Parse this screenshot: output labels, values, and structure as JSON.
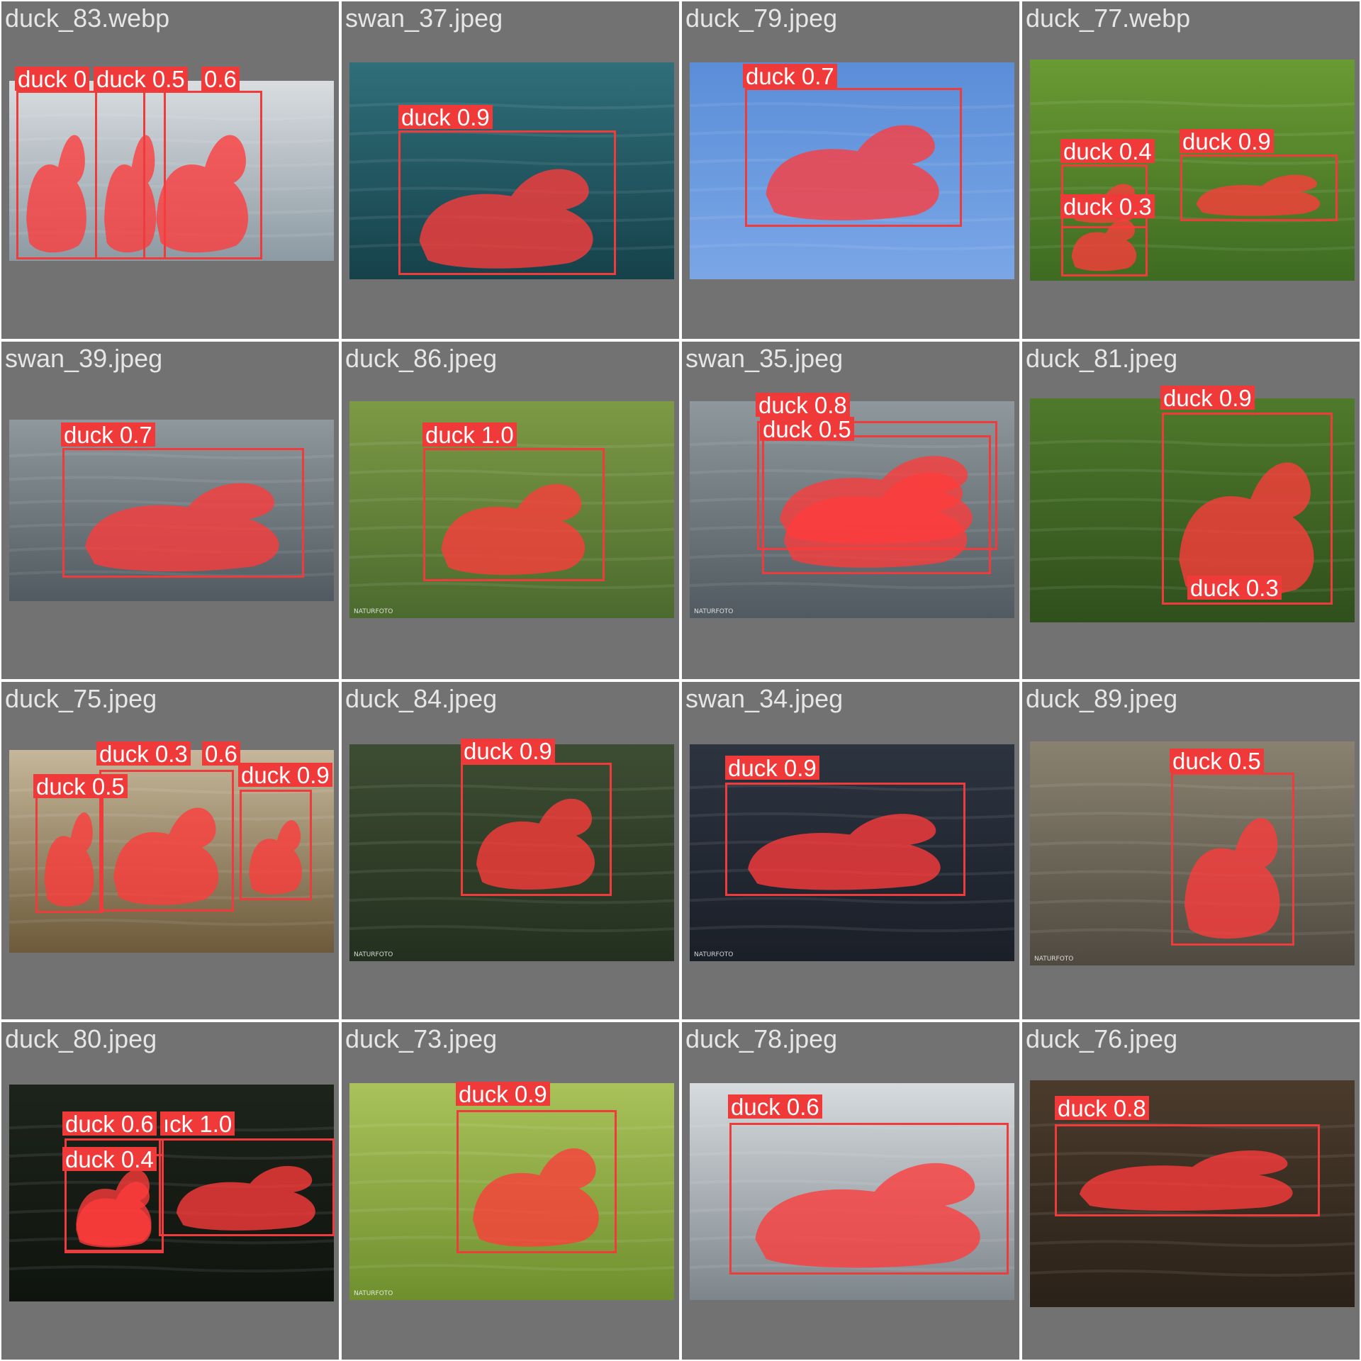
{
  "colors": {
    "cell_background": "#727272",
    "title_text": "#e6e6e6",
    "detection": "#ee3b3b",
    "mask": "#ff3b3b",
    "label_text": "#ffffff"
  },
  "cells": [
    {
      "title": "duck_83.webp",
      "scene": "pale water",
      "detections": [
        {
          "label": "duck 0"
        },
        {
          "label": "duck 0.5"
        },
        {
          "label": "0.6"
        }
      ]
    },
    {
      "title": "swan_37.jpeg",
      "scene": "teal water",
      "detections": [
        {
          "label": "duck 0.9"
        }
      ]
    },
    {
      "title": "duck_79.jpeg",
      "scene": "blue sky",
      "detections": [
        {
          "label": "duck 0.7"
        }
      ]
    },
    {
      "title": "duck_77.webp",
      "scene": "green pond",
      "detections": [
        {
          "label": "duck 0.4"
        },
        {
          "label": "duck 0.3"
        },
        {
          "label": "duck 0.9"
        }
      ]
    },
    {
      "title": "swan_39.jpeg",
      "scene": "grey water",
      "detections": [
        {
          "label": "duck 0.7"
        }
      ]
    },
    {
      "title": "duck_86.jpeg",
      "scene": "green water",
      "watermark": "NATURFOTO",
      "detections": [
        {
          "label": "duck 1.0"
        }
      ]
    },
    {
      "title": "swan_35.jpeg",
      "scene": "grey water",
      "watermark": "NATURFOTO",
      "detections": [
        {
          "label": "duck 0.8"
        },
        {
          "label": "duck 0.5"
        }
      ]
    },
    {
      "title": "duck_81.jpeg",
      "scene": "grass",
      "detections": [
        {
          "label": "duck 0.9"
        },
        {
          "label": "duck 0.3"
        }
      ]
    },
    {
      "title": "duck_75.jpeg",
      "scene": "golden water",
      "detections": [
        {
          "label": "duck 0.3"
        },
        {
          "label": "0.6"
        },
        {
          "label": "duck 0.5"
        },
        {
          "label": "duck 0.9"
        }
      ]
    },
    {
      "title": "duck_84.jpeg",
      "scene": "dark green water",
      "watermark": "NATURFOTO",
      "detections": [
        {
          "label": "duck 0.9"
        }
      ]
    },
    {
      "title": "swan_34.jpeg",
      "scene": "dark water",
      "watermark": "NATURFOTO",
      "detections": [
        {
          "label": "duck 0.9"
        }
      ]
    },
    {
      "title": "duck_89.jpeg",
      "scene": "mudflat",
      "watermark": "NATURFOTO",
      "detections": [
        {
          "label": "duck 0.5"
        }
      ]
    },
    {
      "title": "duck_80.jpeg",
      "scene": "dark pond",
      "detections": [
        {
          "label": "duck 0.6"
        },
        {
          "label": "ıck 1.0"
        },
        {
          "label": "duck 0.4"
        }
      ]
    },
    {
      "title": "duck_73.jpeg",
      "scene": "lime water",
      "watermark": "NATURFOTO",
      "detections": [
        {
          "label": "duck 0.9"
        }
      ]
    },
    {
      "title": "duck_78.jpeg",
      "scene": "silver water",
      "detections": [
        {
          "label": "duck 0.6"
        }
      ]
    },
    {
      "title": "duck_76.jpeg",
      "scene": "brown water",
      "detections": [
        {
          "label": "duck 0.8"
        }
      ]
    }
  ]
}
